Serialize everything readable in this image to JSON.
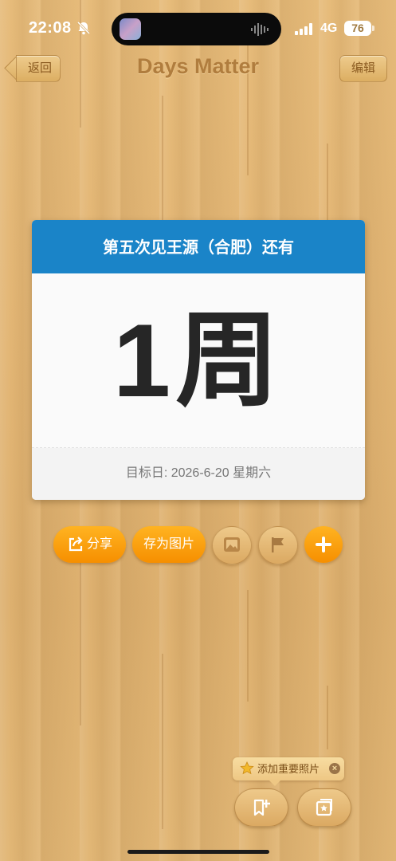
{
  "status_bar": {
    "time": "22:08",
    "network": "4G",
    "battery": "76"
  },
  "nav": {
    "back_label": "返回",
    "title": "Days Matter",
    "edit_label": "编辑"
  },
  "card": {
    "header": "第五次见王源（合肥）还有",
    "value": "1周",
    "target_date": "目标日: 2026-6-20 星期六"
  },
  "actions": {
    "share_label": "分享",
    "save_image_label": "存为图片"
  },
  "tip": {
    "text": "添加重要照片"
  },
  "colors": {
    "card_header": "#1a84c8",
    "accent_orange": "#f79a0c",
    "title_brown": "#b07d3e"
  }
}
